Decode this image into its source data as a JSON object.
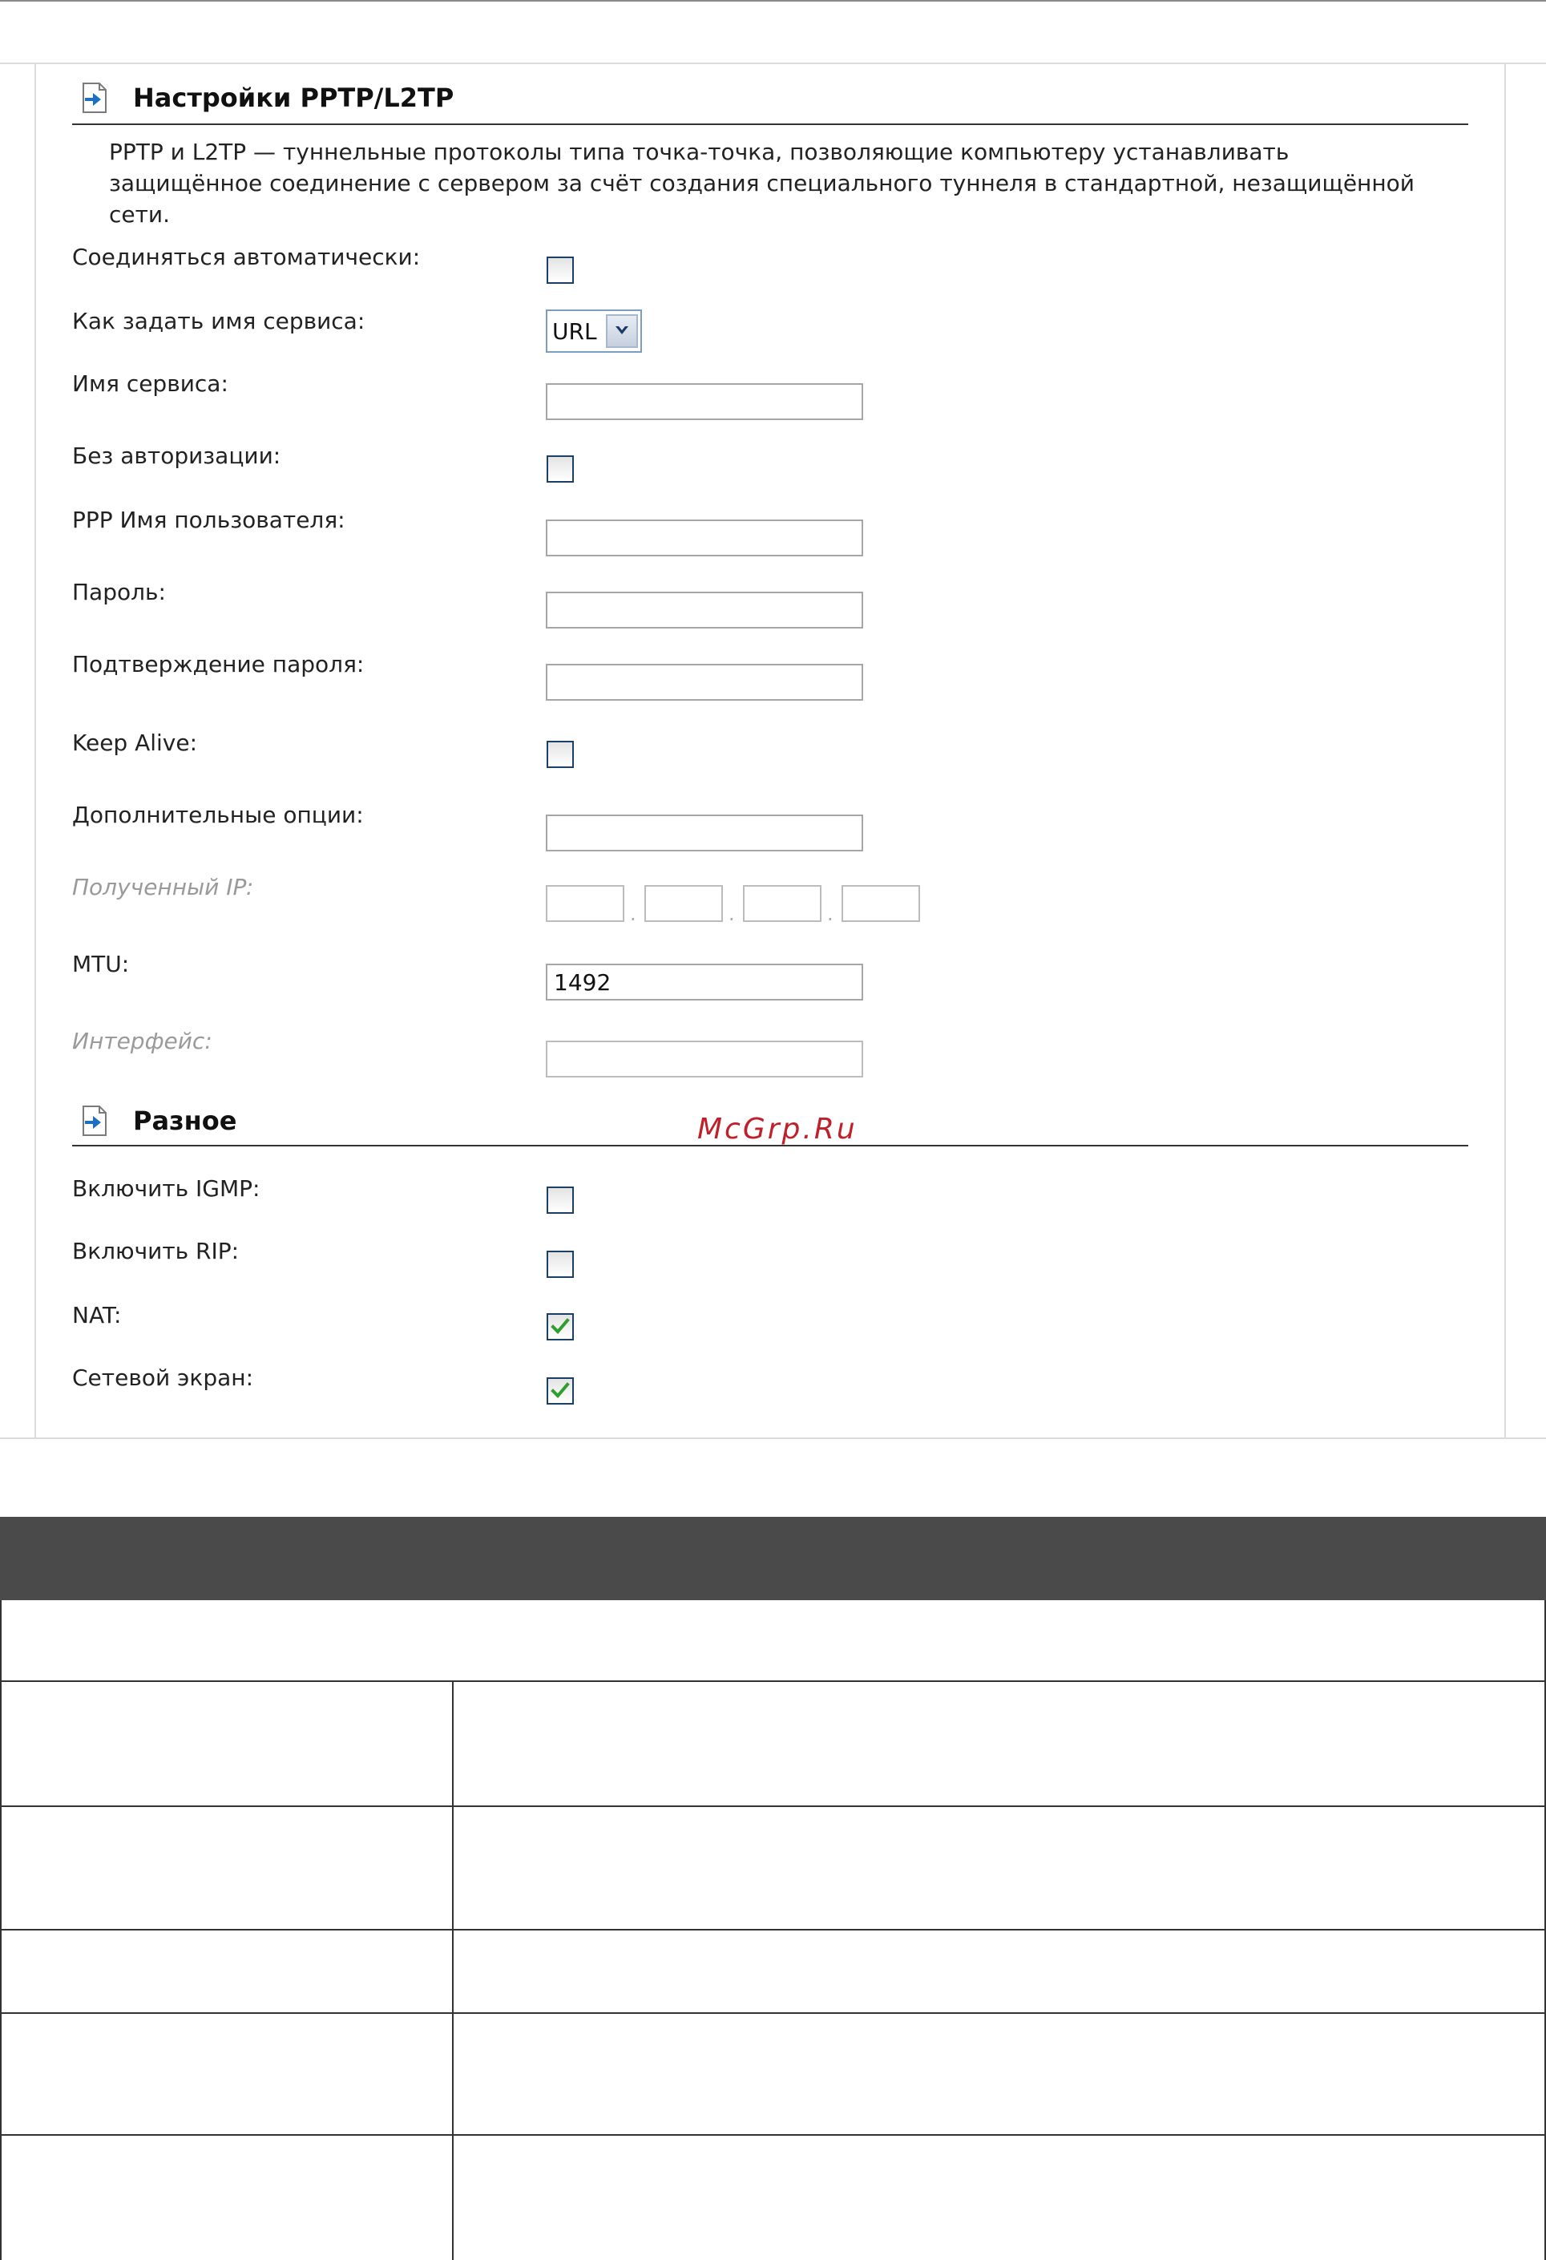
{
  "pptp_section": {
    "title": "Настройки PPTP/L2TP",
    "description": "PPTP и L2TP — туннельные протоколы типа точка-точка, позволяющие компьютеру устанавливать защищённое соединение с сервером за счёт создания специального туннеля в стандартной, незащищённой сети."
  },
  "fields": {
    "auto_connect": {
      "label": "Соединяться автоматически:",
      "checked": false
    },
    "service_name_method": {
      "label": "Как задать имя сервиса:",
      "value": "URL"
    },
    "service_name": {
      "label": "Имя сервиса:",
      "value": ""
    },
    "no_auth": {
      "label": "Без авторизации:",
      "checked": false
    },
    "ppp_username": {
      "label": "PPP Имя пользователя:",
      "value": ""
    },
    "password": {
      "label": "Пароль:",
      "value": ""
    },
    "password_confirm": {
      "label": "Подтверждение пароля:",
      "value": ""
    },
    "keep_alive": {
      "label": "Keep Alive:",
      "checked": false
    },
    "extra_options": {
      "label": "Дополнительные опции:",
      "value": ""
    },
    "received_ip": {
      "label": "Полученный IP:",
      "separator": "."
    },
    "mtu": {
      "label": "MTU:",
      "value": "1492"
    },
    "interface": {
      "label": "Интерфейс:",
      "value": ""
    }
  },
  "misc_section": {
    "title": "Разное",
    "igmp": {
      "label": "Включить IGMP:",
      "checked": false
    },
    "rip": {
      "label": "Включить RIP:",
      "checked": false
    },
    "nat": {
      "label": "NAT:",
      "checked": true
    },
    "firewall": {
      "label": "Сетевой экран:",
      "checked": true
    }
  },
  "watermark": "McGrp.Ru",
  "colors": {
    "table_header": "#4a4a4a",
    "checkmark": "#2f9e2f"
  },
  "icons": {
    "section": "page-arrow-icon",
    "check": "checkmark-icon",
    "dropdown": "chevron-down-icon"
  }
}
